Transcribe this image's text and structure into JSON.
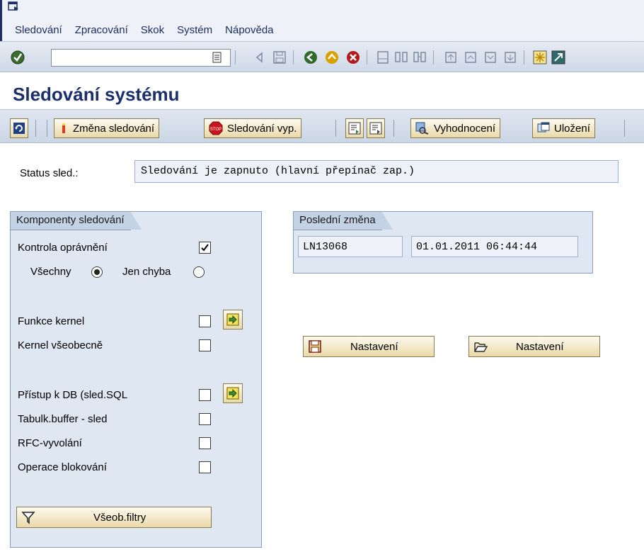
{
  "menu": {
    "items": [
      "Sledování",
      "Zpracování",
      "Skok",
      "Systém",
      "Nápověda"
    ]
  },
  "toolbar": {
    "command_value": ""
  },
  "page": {
    "title": "Sledování systému"
  },
  "app_toolbar": {
    "change_label": "Změna sledování",
    "stop_label": "Sledování vyp.",
    "evaluate_label": "Vyhodnocení",
    "save_label": "Uložení"
  },
  "status": {
    "label": "Status sled.:",
    "value": "Sledování je zapnuto (hlavní přepínač zap.)"
  },
  "components": {
    "title": "Komponenty sledování",
    "auth_check": {
      "label": "Kontrola oprávnění",
      "checked": true
    },
    "radio_all": {
      "label": "Všechny",
      "selected": true
    },
    "radio_errors": {
      "label": "Jen chyba",
      "selected": false
    },
    "kernel_functions": {
      "label": "Funkce kernel",
      "checked": false
    },
    "kernel_general": {
      "label": "Kernel všeobecně",
      "checked": false
    },
    "db_access": {
      "label": "Přístup k DB (sled.SQL",
      "checked": false
    },
    "table_buffer": {
      "label": "Tabulk.buffer - sled",
      "checked": false
    },
    "rfc_calls": {
      "label": "RFC-vyvolání",
      "checked": false
    },
    "lock_ops": {
      "label": "Operace blokování",
      "checked": false
    },
    "filters_button": "Všeob.filtry"
  },
  "last_change": {
    "title": "Poslední změna",
    "user": "LN13068",
    "timestamp": "01.01.2011 06:44:44"
  },
  "settings": {
    "save_label": "Nastavení",
    "open_label": "Nastavení"
  },
  "colors": {
    "title": "#1a2f6b",
    "group_bg": "#dfe7f3",
    "button": "#ead9a8"
  }
}
